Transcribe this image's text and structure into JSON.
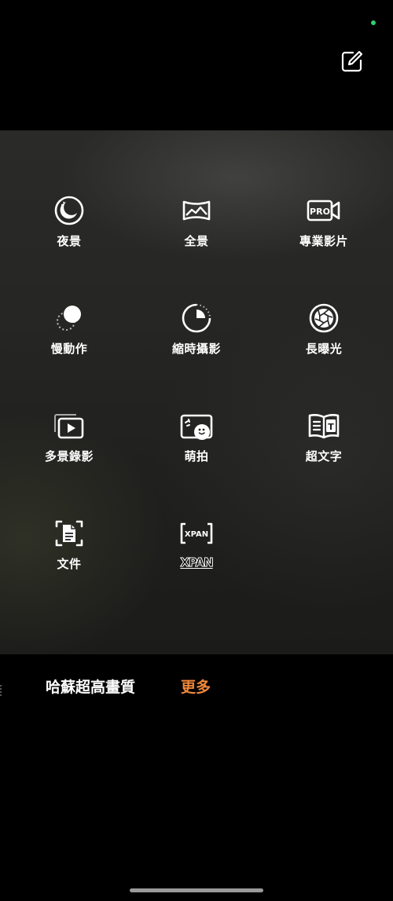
{
  "header": {
    "edit_icon": "edit-pencil-icon"
  },
  "modes": [
    {
      "label": "夜景",
      "icon": "night-moon-icon"
    },
    {
      "label": "全景",
      "icon": "panorama-icon"
    },
    {
      "label": "專業影片",
      "icon": "pro-video-icon",
      "icon_text": "PRO"
    },
    {
      "label": "慢動作",
      "icon": "slow-motion-icon"
    },
    {
      "label": "縮時攝影",
      "icon": "time-lapse-icon"
    },
    {
      "label": "長曝光",
      "icon": "long-exposure-aperture-icon"
    },
    {
      "label": "多景錄影",
      "icon": "multi-scene-video-icon"
    },
    {
      "label": "萌拍",
      "icon": "cute-photo-icon"
    },
    {
      "label": "超文字",
      "icon": "super-text-icon",
      "icon_text": "T"
    },
    {
      "label": "文件",
      "icon": "document-scan-icon"
    },
    {
      "label": "XPAN",
      "icon": "xpan-frame-icon",
      "icon_text": "XPAN"
    }
  ],
  "bottom_tabs": {
    "hasselblad": "哈蘇超高畫質",
    "more": "更多"
  },
  "colors": {
    "accent": "#f0883a",
    "status_dot": "#2fd36a"
  }
}
